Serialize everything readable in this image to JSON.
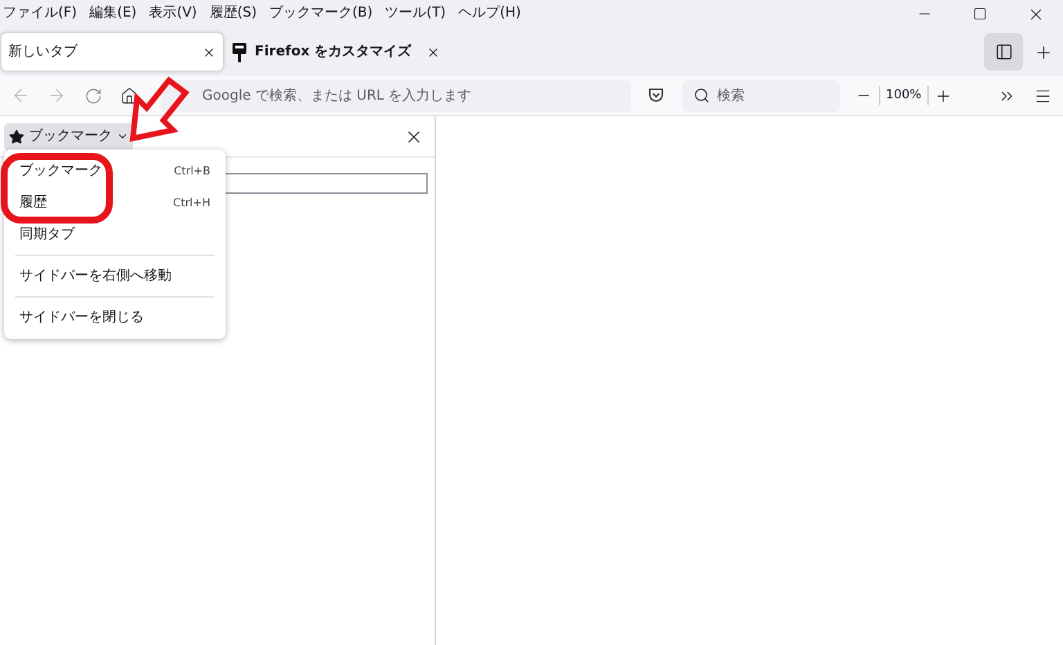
{
  "menu_bar": [
    "ファイル(F)",
    "編集(E)",
    "表示(V)",
    "履歴(S)",
    "ブックマーク(B)",
    "ツール(T)",
    "ヘルプ(H)"
  ],
  "tabs": [
    {
      "title": "新しいタブ",
      "selected": true,
      "kind": "blank"
    },
    {
      "title": "Firefox をカスタマイズ",
      "selected": false,
      "kind": "customize"
    }
  ],
  "toolbar": {
    "address_placeholder": "Google で検索、または URL を入力します",
    "search_placeholder": "検索",
    "zoom": "100%"
  },
  "sidebar": {
    "title": "ブックマーク"
  },
  "sidebar_menu": [
    {
      "kind": "item",
      "label": "ブックマーク",
      "shortcut": "Ctrl+B"
    },
    {
      "kind": "item",
      "label": "履歴",
      "shortcut": "Ctrl+H"
    },
    {
      "kind": "item",
      "label": "同期タブ"
    },
    {
      "kind": "separator"
    },
    {
      "kind": "item",
      "label": "サイドバーを右側へ移動"
    },
    {
      "kind": "separator"
    },
    {
      "kind": "item",
      "label": "サイドバーを閉じる"
    }
  ]
}
